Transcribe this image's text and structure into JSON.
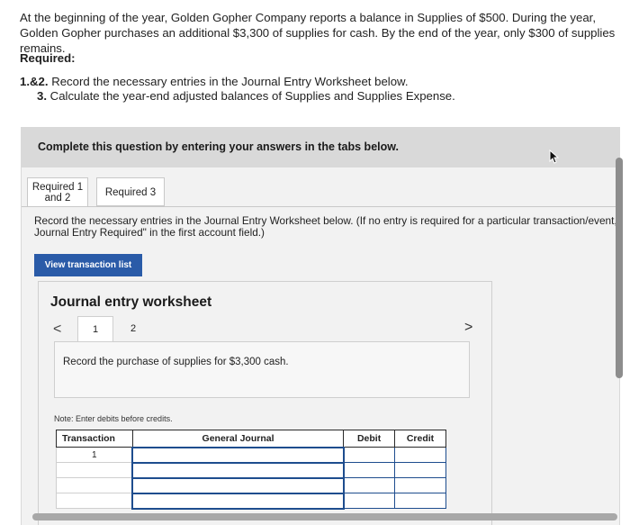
{
  "problem": {
    "intro": "At the beginning of the year, Golden Gopher Company reports a balance in Supplies of $500. During the year, Golden Gopher purchases an additional $3,300 of supplies for cash. By the end of the year, only $300 of supplies remains.",
    "required_heading": "Required:",
    "req1_num": "1.&2.",
    "req1_text": " Record the necessary entries in the Journal Entry Worksheet below.",
    "req2_num": "3.",
    "req2_text": " Calculate the year-end adjusted balances of Supplies and Supplies Expense."
  },
  "panel": {
    "title": "Complete this question by entering your answers in the tabs below.",
    "tabs": [
      {
        "line1": "Required 1",
        "line2": "and 2"
      },
      {
        "label": "Required 3"
      }
    ],
    "instruction": "Record the necessary entries in the Journal Entry Worksheet below. (If no entry is required for a particular transaction/event,",
    "instruction2": "Journal Entry Required\" in the first account field.)",
    "view_button": "View transaction list"
  },
  "worksheet": {
    "title": "Journal entry worksheet",
    "prev_icon": "<",
    "next_icon": ">",
    "pages": [
      "1",
      "2"
    ],
    "record_text": "Record the purchase of supplies for $3,300 cash.",
    "note": "Note: Enter debits before credits.",
    "columns": [
      "Transaction",
      "General Journal",
      "Debit",
      "Credit"
    ],
    "rows": [
      {
        "transaction": "1"
      },
      {
        "transaction": ""
      },
      {
        "transaction": ""
      },
      {
        "transaction": ""
      }
    ]
  },
  "icons": {
    "cursor": "cursor-arrow-icon"
  },
  "colors": {
    "accent": "#2a5ba8",
    "table_border": "#1e4d8e",
    "panel_header": "#d9d9d9"
  }
}
